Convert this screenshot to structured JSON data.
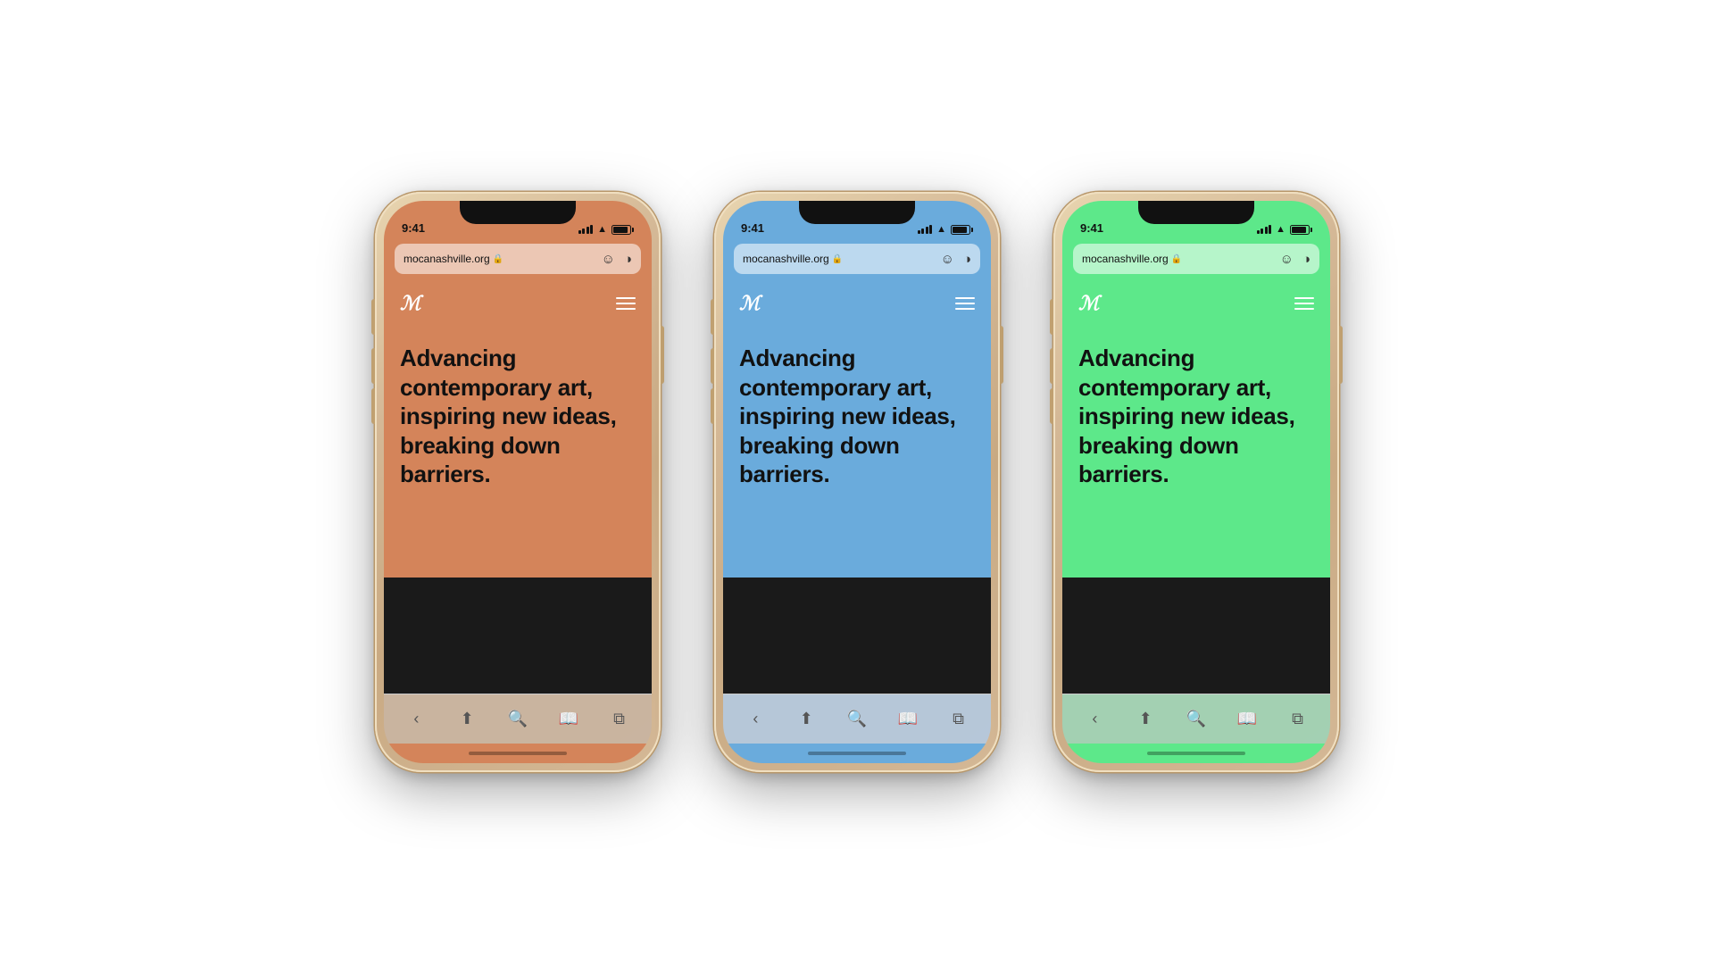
{
  "background": "#ffffff",
  "phones": [
    {
      "id": "phone-orange",
      "colorClass": "phone-orange",
      "bgColor": "#d4845a",
      "statusTime": "9:41",
      "urlText": "mocanashville.org",
      "heroText": "Advancing contemporary art, inspiring new ideas, breaking down barriers.",
      "accentColor": "#d4845a"
    },
    {
      "id": "phone-blue",
      "colorClass": "phone-blue",
      "bgColor": "#6aabdc",
      "statusTime": "9:41",
      "urlText": "mocanashville.org",
      "heroText": "Advancing contemporary art, inspiring new ideas, breaking down barriers.",
      "accentColor": "#6aabdc"
    },
    {
      "id": "phone-green",
      "colorClass": "phone-green",
      "bgColor": "#5de88a",
      "statusTime": "9:41",
      "urlText": "mocanashville.org",
      "heroText": "Advancing contemporary art, inspiring new ideas, breaking down barriers.",
      "accentColor": "#5de88a"
    }
  ],
  "toolbar": {
    "back": "‹",
    "share": "↑",
    "search": "⊕",
    "bookmarks": "□",
    "tabs": "⧉"
  }
}
